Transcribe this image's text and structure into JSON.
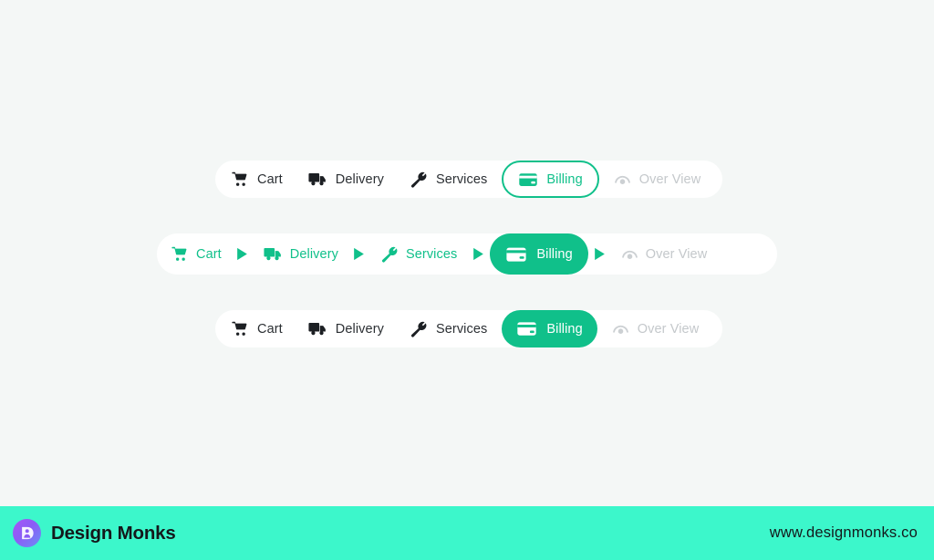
{
  "page": {
    "background_color": "#f4f7f6",
    "accent_color": "#10c08a",
    "disabled_color": "#c4c8cb",
    "dark_text_color": "#2b2f33"
  },
  "variants": [
    {
      "id": "outline-active",
      "style": "outlined-active-pill",
      "steps": [
        {
          "label": "Cart",
          "icon": "shopping-cart-icon",
          "state": "default"
        },
        {
          "label": "Delivery",
          "icon": "delivery-truck-icon",
          "state": "default"
        },
        {
          "label": "Services",
          "icon": "wrench-icon",
          "state": "default"
        },
        {
          "label": "Billing",
          "icon": "credit-card-icon",
          "state": "active"
        },
        {
          "label": "Over View",
          "icon": "overview-eye-icon",
          "state": "disabled"
        }
      ]
    },
    {
      "id": "arrow-separated",
      "style": "filled-active-pill-with-arrows",
      "separator_icon": "caret-right-icon",
      "steps": [
        {
          "label": "Cart",
          "icon": "shopping-cart-icon",
          "state": "done"
        },
        {
          "label": "Delivery",
          "icon": "delivery-truck-icon",
          "state": "done"
        },
        {
          "label": "Services",
          "icon": "wrench-icon",
          "state": "done"
        },
        {
          "label": "Billing",
          "icon": "credit-card-icon",
          "state": "active"
        },
        {
          "label": "Over View",
          "icon": "overview-eye-icon",
          "state": "disabled"
        }
      ]
    },
    {
      "id": "filled-active",
      "style": "filled-active-pill",
      "steps": [
        {
          "label": "Cart",
          "icon": "shopping-cart-icon",
          "state": "default"
        },
        {
          "label": "Delivery",
          "icon": "delivery-truck-icon",
          "state": "default"
        },
        {
          "label": "Services",
          "icon": "wrench-icon",
          "state": "default"
        },
        {
          "label": "Billing",
          "icon": "credit-card-icon",
          "state": "active"
        },
        {
          "label": "Over View",
          "icon": "overview-eye-icon",
          "state": "disabled"
        }
      ]
    }
  ],
  "footer": {
    "brand_name": "Design Monks",
    "logo_icon": "design-monks-logo",
    "website": "www.designmonks.co",
    "background_color": "#3cf7cb",
    "text_color": "#14181b"
  }
}
